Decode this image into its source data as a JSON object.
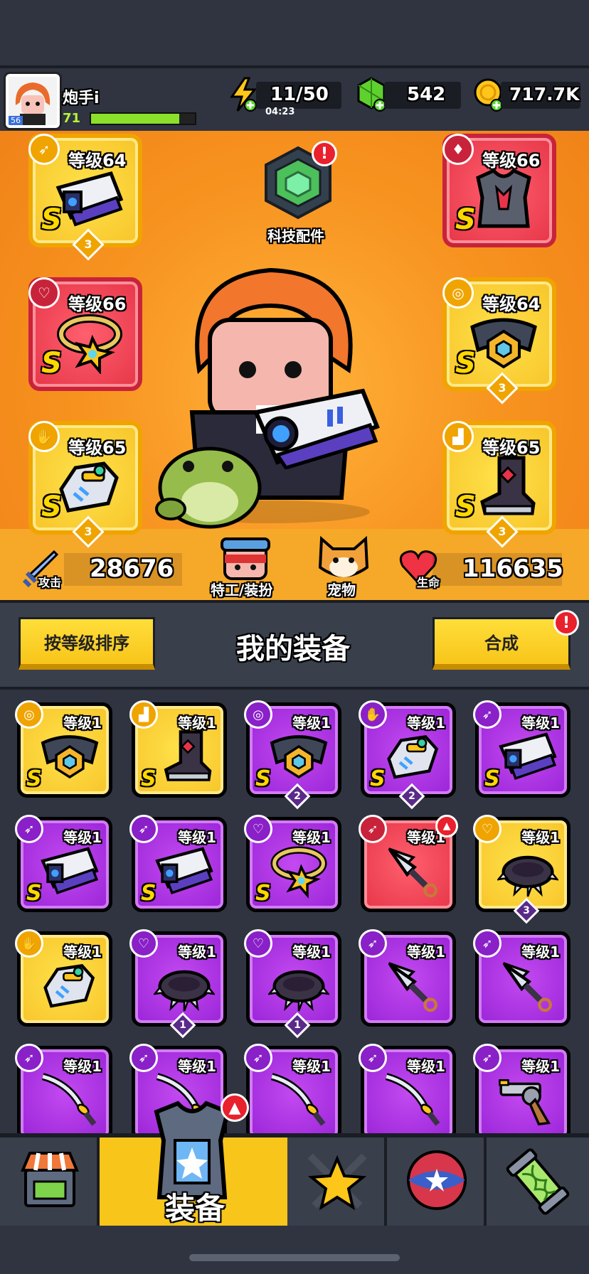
{
  "header": {
    "player_name": "炮手i",
    "avatar_level": "56",
    "player_level": "71",
    "xp_fraction": 0.85,
    "energy": "11/50",
    "energy_timer": "04:23",
    "gems": "542",
    "gold": "717.7K"
  },
  "hero": {
    "tech_label": "科技配件",
    "equipped": [
      {
        "slot": "weapon",
        "level": "等级64",
        "rank": "S",
        "stars": "3",
        "color": "gold"
      },
      {
        "slot": "armor",
        "level": "等级66",
        "rank": "S",
        "stars": "",
        "color": "red"
      },
      {
        "slot": "necklace",
        "level": "等级66",
        "rank": "S",
        "stars": "",
        "color": "red"
      },
      {
        "slot": "belt",
        "level": "等级64",
        "rank": "S",
        "stars": "3",
        "color": "gold"
      },
      {
        "slot": "gloves",
        "level": "等级65",
        "rank": "S",
        "stars": "3",
        "color": "gold"
      },
      {
        "slot": "boots",
        "level": "等级65",
        "rank": "S",
        "stars": "3",
        "color": "gold"
      }
    ],
    "attack_label": "攻击",
    "attack_value": "28676",
    "agent_label": "特工/装扮",
    "pet_label": "宠物",
    "hp_label": "生命",
    "hp_value": "116635"
  },
  "equipment": {
    "sort_button": "按等级排序",
    "title": "我的装备",
    "merge_button": "合成",
    "items": [
      {
        "level": "等级1",
        "rank": "S",
        "count": "",
        "color": "gold",
        "icon": "belt-icon"
      },
      {
        "level": "等级1",
        "rank": "S",
        "count": "",
        "color": "gold",
        "icon": "boots-icon"
      },
      {
        "level": "等级1",
        "rank": "S",
        "count": "2",
        "color": "purple",
        "icon": "belt-icon"
      },
      {
        "level": "等级1",
        "rank": "S",
        "count": "2",
        "color": "purple",
        "icon": "gloves-icon"
      },
      {
        "level": "等级1",
        "rank": "S",
        "count": "",
        "color": "purple",
        "icon": "gun-icon"
      },
      {
        "level": "等级1",
        "rank": "S",
        "count": "",
        "color": "purple",
        "icon": "gun-icon"
      },
      {
        "level": "等级1",
        "rank": "S",
        "count": "",
        "color": "purple",
        "icon": "gun-icon"
      },
      {
        "level": "等级1",
        "rank": "S",
        "count": "",
        "color": "purple",
        "icon": "necklace-icon"
      },
      {
        "level": "等级1",
        "rank": "",
        "count": "",
        "color": "red",
        "icon": "kunai-icon"
      },
      {
        "level": "等级1",
        "rank": "",
        "count": "3",
        "color": "gold",
        "icon": "spiked-collar-icon"
      },
      {
        "level": "等级1",
        "rank": "",
        "count": "",
        "color": "gold",
        "icon": "gloves-icon"
      },
      {
        "level": "等级1",
        "rank": "",
        "count": "1",
        "color": "purple",
        "icon": "spiked-collar-icon"
      },
      {
        "level": "等级1",
        "rank": "",
        "count": "1",
        "color": "purple",
        "icon": "spiked-collar-icon"
      },
      {
        "level": "等级1",
        "rank": "",
        "count": "",
        "color": "purple",
        "icon": "kunai-icon"
      },
      {
        "level": "等级1",
        "rank": "",
        "count": "",
        "color": "purple",
        "icon": "kunai-icon"
      },
      {
        "level": "等级1",
        "rank": "",
        "count": "",
        "color": "purple",
        "icon": "katana-icon"
      },
      {
        "level": "等级1",
        "rank": "",
        "count": "",
        "color": "purple",
        "icon": "katana-icon"
      },
      {
        "level": "等级1",
        "rank": "",
        "count": "",
        "color": "purple",
        "icon": "katana-icon"
      },
      {
        "level": "等级1",
        "rank": "",
        "count": "",
        "color": "purple",
        "icon": "katana-icon"
      },
      {
        "level": "等级1",
        "rank": "",
        "count": "",
        "color": "purple",
        "icon": "revolver-icon"
      }
    ]
  },
  "nav": {
    "active_label": "装备"
  },
  "colors": {
    "gold": "#f7c52a",
    "purple": "#9a24d8",
    "red": "#e63648",
    "accent_orange": "#f7921f"
  }
}
